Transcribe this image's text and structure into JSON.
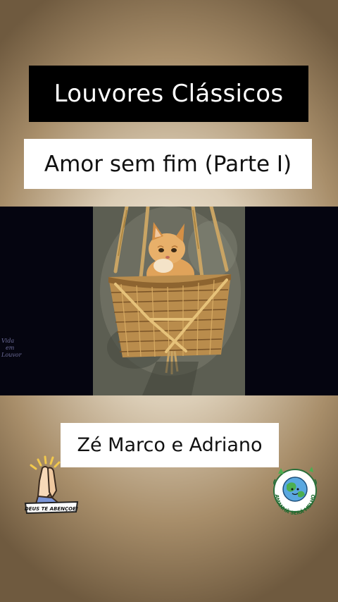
{
  "header": {
    "title": "Louvores Clássicos"
  },
  "song": {
    "title": "Amor sem fim (Parte I)"
  },
  "video": {
    "image": "kitten-in-basket",
    "watermark_lines": [
      "Vida",
      "em",
      "Louvor"
    ]
  },
  "artist": {
    "name": "Zé Marco e Adriano"
  },
  "badges": {
    "left": {
      "icon": "praying-hands-icon",
      "text": "DEUS TE ABENÇOE!"
    },
    "right": {
      "icon": "globe-icon",
      "text": "O AMANHÃ SERÁ MELHOR!"
    }
  }
}
